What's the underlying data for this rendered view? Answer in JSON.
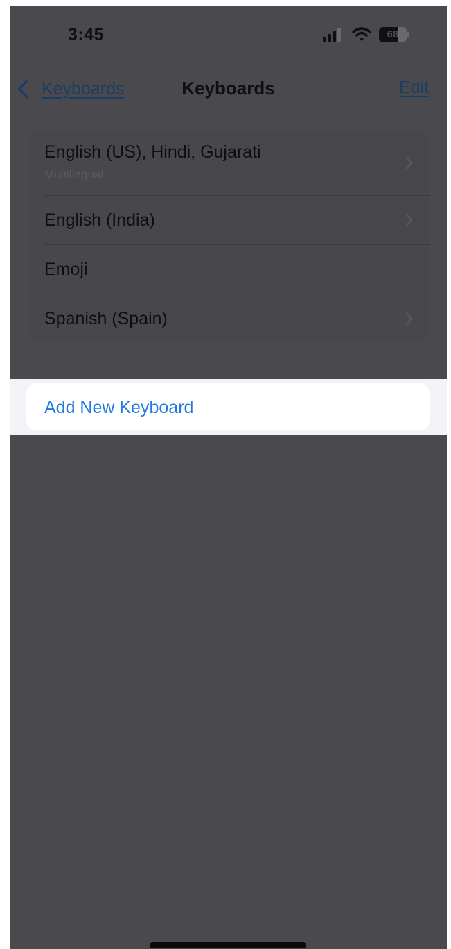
{
  "status_bar": {
    "time": "3:45",
    "battery_percent": 68,
    "battery_text": "68",
    "icons": [
      "signal-icon",
      "wifi-icon",
      "battery-icon"
    ]
  },
  "nav": {
    "back_label": "Keyboards",
    "title": "Keyboards",
    "edit_label": "Edit"
  },
  "keyboards": [
    {
      "title": "English (US), Hindi, Gujarati",
      "subtitle": "Multilingual",
      "has_chevron": true
    },
    {
      "title": "English (India)",
      "has_chevron": true
    },
    {
      "title": "Emoji",
      "has_chevron": false
    },
    {
      "title": "Spanish (Spain)",
      "has_chevron": true
    }
  ],
  "add_keyboard": {
    "label": "Add New Keyboard"
  },
  "colors": {
    "accent_link": "#1f7ae0",
    "dimmed_background": "#4a4a4e",
    "highlight_background": "#f2f2f7"
  }
}
